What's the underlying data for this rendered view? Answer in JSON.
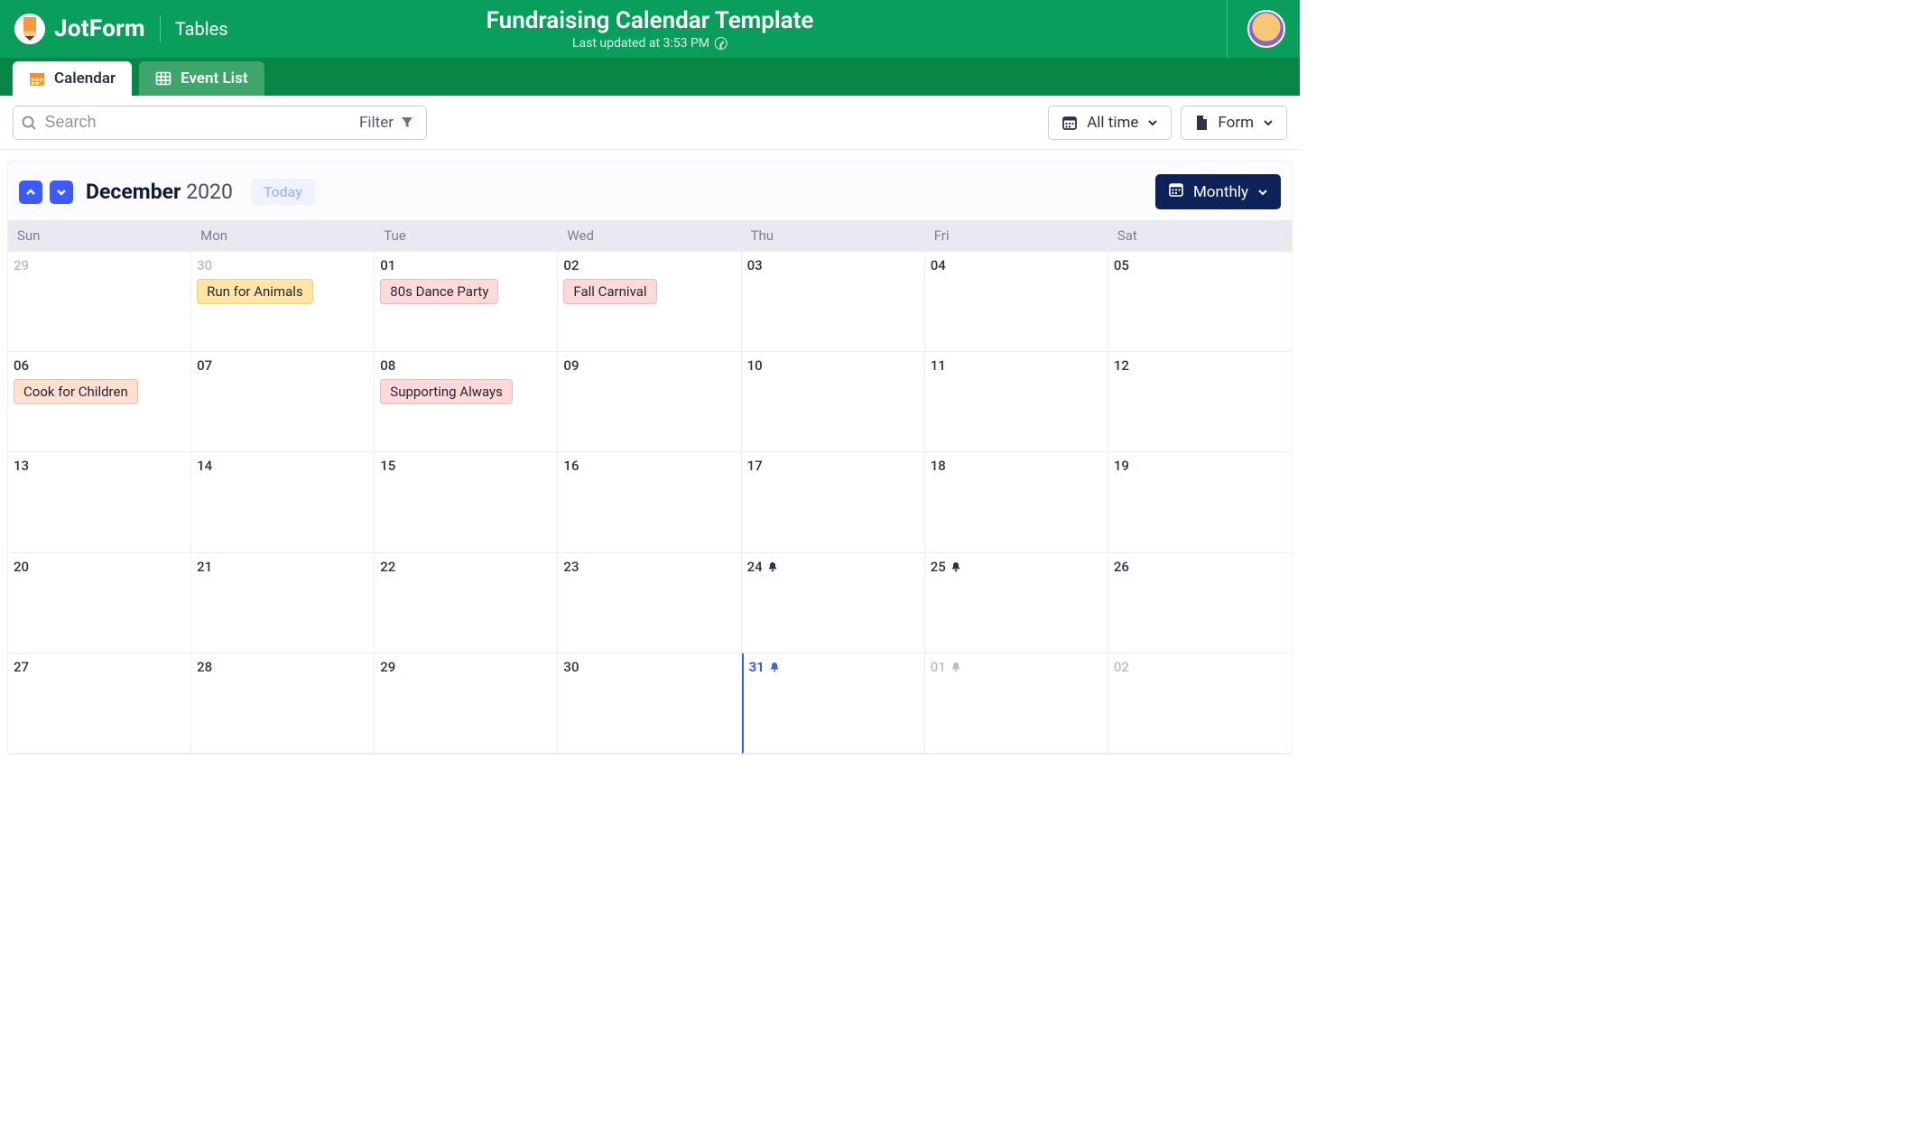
{
  "header": {
    "brand_main": "JotForm",
    "brand_sub": "Tables",
    "title": "Fundraising Calendar Template",
    "subtitle": "Last updated at 3:53 PM"
  },
  "tabs": {
    "calendar": "Calendar",
    "event_list": "Event List"
  },
  "toolbar": {
    "search_placeholder": "Search",
    "filter_label": "Filter",
    "alltime_label": "All time",
    "form_label": "Form"
  },
  "calendar_head": {
    "month": "December",
    "year": "2020",
    "today_label": "Today",
    "view_label": "Monthly"
  },
  "weekdays": [
    "Sun",
    "Mon",
    "Tue",
    "Wed",
    "Thu",
    "Fri",
    "Sat"
  ],
  "events": {
    "run_for_animals": "Run for Animals",
    "eighties_dance": "80s Dance Party",
    "fall_carnival": "Fall Carnival",
    "cook_for_children": "Cook for Children",
    "supporting_always": "Supporting Always"
  },
  "calendar": {
    "rows": [
      [
        {
          "num": "29",
          "out": true
        },
        {
          "num": "30",
          "out": true,
          "event": "run_for_animals",
          "color": "yellow"
        },
        {
          "num": "01",
          "event": "eighties_dance",
          "color": "pink"
        },
        {
          "num": "02",
          "event": "fall_carnival",
          "color": "pink"
        },
        {
          "num": "03"
        },
        {
          "num": "04"
        },
        {
          "num": "05"
        }
      ],
      [
        {
          "num": "06",
          "event": "cook_for_children",
          "color": "peach"
        },
        {
          "num": "07"
        },
        {
          "num": "08",
          "event": "supporting_always",
          "color": "pink"
        },
        {
          "num": "09"
        },
        {
          "num": "10"
        },
        {
          "num": "11"
        },
        {
          "num": "12"
        }
      ],
      [
        {
          "num": "13"
        },
        {
          "num": "14"
        },
        {
          "num": "15"
        },
        {
          "num": "16"
        },
        {
          "num": "17"
        },
        {
          "num": "18"
        },
        {
          "num": "19"
        }
      ],
      [
        {
          "num": "20"
        },
        {
          "num": "21"
        },
        {
          "num": "22"
        },
        {
          "num": "23"
        },
        {
          "num": "24",
          "bell": true
        },
        {
          "num": "25",
          "bell": true
        },
        {
          "num": "26"
        }
      ],
      [
        {
          "num": "27"
        },
        {
          "num": "28"
        },
        {
          "num": "29"
        },
        {
          "num": "30"
        },
        {
          "num": "31",
          "bell": true,
          "today": true
        },
        {
          "num": "01",
          "out": true,
          "bell": true,
          "bell_out": true
        },
        {
          "num": "02",
          "out": true
        }
      ]
    ]
  }
}
